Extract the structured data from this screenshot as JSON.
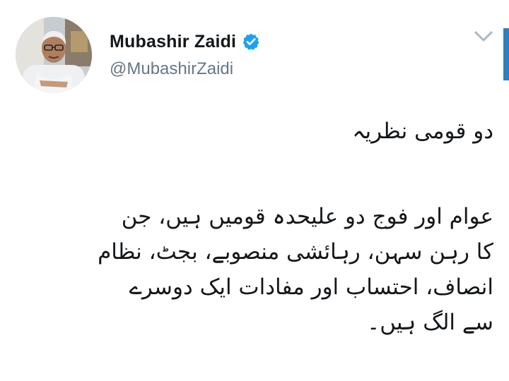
{
  "tweet": {
    "display_name": "Mubashir Zaidi",
    "handle": "@MubashirZaidi",
    "verified_icon": "verified-badge-icon",
    "menu_icon": "chevron-down-icon",
    "heading": "دو قومی نظریہ",
    "lines": [
      "عوام اور فوج دو علیحدہ قومیں ہیں، جن",
      "کا رہن سہن، رہائشی منصوبے، بجٹ، نظام",
      "انصاف، احتساب اور مفادات ایک دوسرے",
      "سے الگ ہیں۔"
    ]
  },
  "colors": {
    "name": "#14171a",
    "handle": "#657786",
    "verified": "#1da1f2",
    "chevron": "#aab8c2",
    "scroll_edge": "#2f7fc1"
  }
}
